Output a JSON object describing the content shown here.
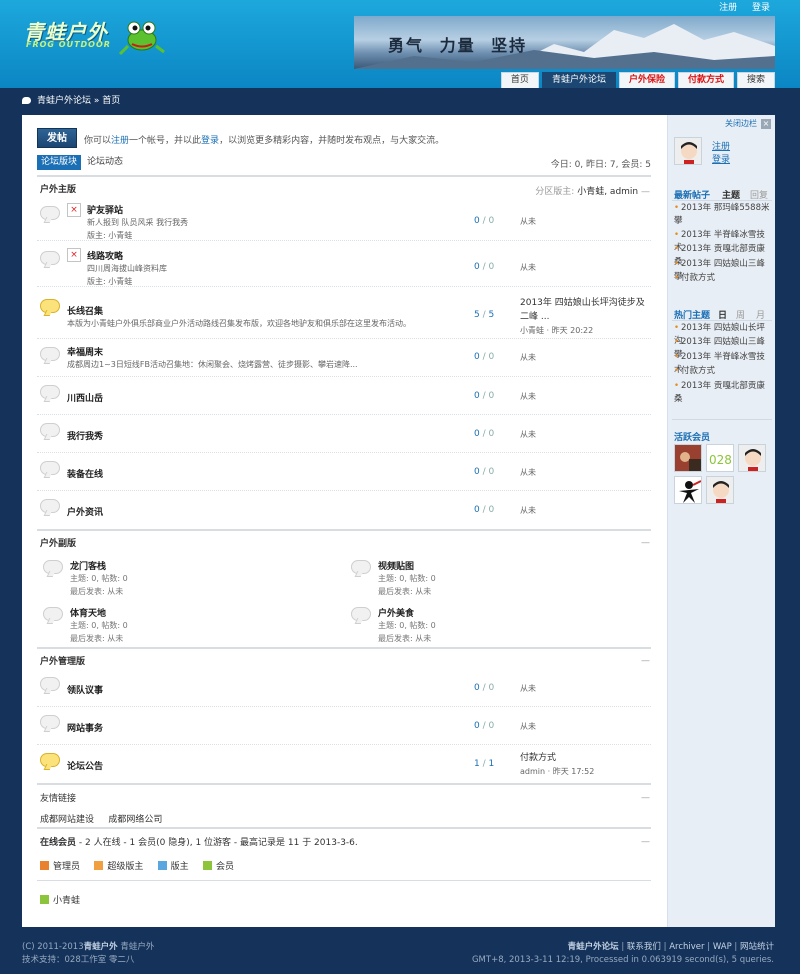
{
  "colors": {
    "header_top": "#1da8dc",
    "header_bottom": "#0b86c4",
    "page_bg": "#14325a",
    "accent": "#1a6fb5",
    "nav_active": "#1b4772"
  },
  "top_links": {
    "register": "注册",
    "login": "登录"
  },
  "logo": {
    "cn": "青蛙户外",
    "en": "FROG OUTDOOR"
  },
  "banner": {
    "text": "勇气  力量  坚持"
  },
  "nav": {
    "tabs": [
      "首页",
      "青蛙户外论坛",
      "户外保险",
      "付款方式",
      "搜索"
    ]
  },
  "breadcrumb": "青蛙户外论坛 » 首页",
  "post_button": "发帖",
  "welcome": {
    "pre": "你可以",
    "register": "注册",
    "mid": "一个帐号，并以此",
    "login": "登录",
    "post": "，以浏览更多精彩内容，并随时发布观点，与大家交流。"
  },
  "tabs": [
    "论坛版块",
    "论坛动态"
  ],
  "stats": "今日: 0, 昨日: 7, 会员: 5",
  "section_main": {
    "title": "户外主版",
    "moderators_label": "分区版主:",
    "moderators": "小青蛙,  admin"
  },
  "main_forums": [
    {
      "name": "驴友驿站",
      "desc": "新人报到 队员风采 我行我秀",
      "mod": "版主: 小青蛙",
      "threads": "0",
      "posts": "0",
      "last": "从未"
    },
    {
      "name": "线路攻略",
      "desc": "四川周海拔山峰资料库",
      "mod": "版主: 小青蛙",
      "threads": "0",
      "posts": "0",
      "last": "从未"
    },
    {
      "name": "长线召集",
      "desc": "本版为小青蛙户外俱乐部商业户外活动路线召集发布版，欢迎各地驴友和俱乐部在这里发布活动。",
      "mod": "",
      "threads": "5",
      "posts": "5",
      "last_title": "2013年 四姑娘山长坪沟徒步及二峰 ...",
      "last_by": "小青蛙 · 昨天 20:22"
    },
    {
      "name": "幸福周末",
      "desc": "成都周边1~3日短线FB活动召集地：休闲聚会、烧烤露营、徒步摄影、攀岩速降...",
      "mod": "",
      "threads": "0",
      "posts": "0",
      "last": "从未"
    },
    {
      "name": "川西山岳",
      "desc": "",
      "mod": "",
      "threads": "0",
      "posts": "0",
      "last": "从未"
    },
    {
      "name": "我行我秀",
      "desc": "",
      "mod": "",
      "threads": "0",
      "posts": "0",
      "last": "从未"
    },
    {
      "name": "装备在线",
      "desc": "",
      "mod": "",
      "threads": "0",
      "posts": "0",
      "last": "从未"
    },
    {
      "name": "户外资讯",
      "desc": "",
      "mod": "",
      "threads": "0",
      "posts": "0",
      "last": "从未"
    }
  ],
  "section_sub": {
    "title": "户外副版",
    "more": "—"
  },
  "sub_forums": [
    {
      "name": "龙门客栈",
      "l1": "主题: 0, 帖数: 0",
      "l2": "最后发表: 从未"
    },
    {
      "name": "视频贴图",
      "l1": "主题: 0, 帖数: 0",
      "l2": "最后发表: 从未"
    },
    {
      "name": "体育天地",
      "l1": "主题: 0, 帖数: 0",
      "l2": "最后发表: 从未"
    },
    {
      "name": "户外美食",
      "l1": "主题: 0, 帖数: 0",
      "l2": "最后发表: 从未"
    }
  ],
  "section_mgmt": {
    "title": "户外管理版",
    "more": "—"
  },
  "mgmt_forums": [
    {
      "name": "领队议事",
      "threads": "0",
      "posts": "0",
      "last": "从未"
    },
    {
      "name": "网站事务",
      "threads": "0",
      "posts": "0",
      "last": "从未"
    },
    {
      "name": "论坛公告",
      "threads": "1",
      "posts": "1",
      "last_title": "付款方式",
      "last_by": "admin · 昨天 17:52"
    }
  ],
  "links": {
    "title": "友情链接",
    "items": [
      "成都网站建设",
      "成都网络公司"
    ]
  },
  "online": {
    "text_a": "在线会员",
    "text_b": " - 2 人在线 - 1 会员(0 隐身), 1 位游客 - 最高记录是 11 于 2013-3-6."
  },
  "legend": [
    "管理员",
    "超级版主",
    "版主",
    "会员"
  ],
  "online_user": "小青蛙",
  "side": {
    "close": "关闭边栏",
    "register": "注册",
    "login": "登录",
    "newest_head": "最新帖子",
    "newest_tabs": [
      "主题",
      "回复"
    ],
    "newest": [
      "2013年 那玛峰5588米攀",
      "2013年 半脊峰冰雪技术",
      "2013年 贡嘎北部贡康桑",
      "2013年 四姑娘山三峰攀",
      "付款方式"
    ],
    "hot_head": "热门主题",
    "hot_tabs": [
      "日",
      "周",
      "月"
    ],
    "hot": [
      "2013年 四姑娘山长坪沟",
      "2013年 四姑娘山三峰攀",
      "2013年 半脊峰冰雪技术",
      "付款方式",
      "2013年 贡嘎北部贡康桑"
    ],
    "active_head": "活跃会员",
    "member_logo_text": "028"
  },
  "footer": {
    "copy": "(C) 2011-2013",
    "copy_b": "青蛙户外",
    "copy_c": "青蛙户外",
    "tech": "技术支持：028工作室  零二八",
    "links": [
      "青蛙户外论坛",
      "联系我们",
      "Archiver",
      "WAP",
      "网站统计"
    ],
    "meta": "GMT+8, 2013-3-11 12:19, Processed in 0.063919 second(s), 5 queries."
  }
}
